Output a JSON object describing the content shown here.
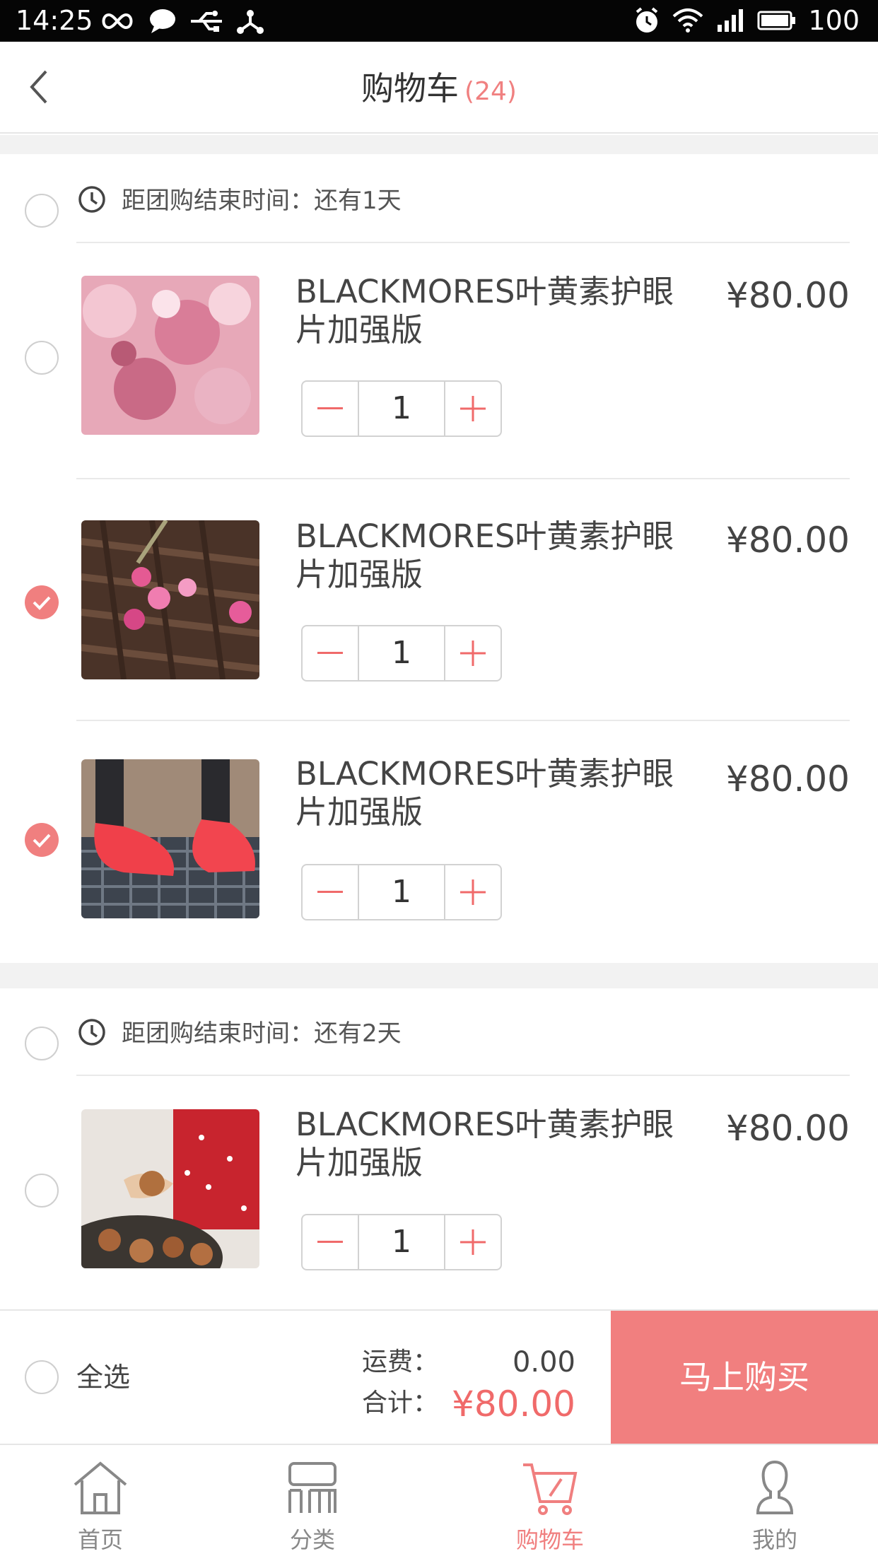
{
  "status_bar": {
    "time": "14:25",
    "level": "100"
  },
  "header": {
    "title": "购物车",
    "count": "(24)"
  },
  "groups": [
    {
      "countdown": "距团购结束时间：还有1天"
    },
    {
      "countdown": "距团购结束时间：还有2天"
    }
  ],
  "items": [
    {
      "name": "BLACKMORES叶黄素护眼片加强版",
      "price": "¥80.00",
      "qty": "1",
      "selected": false
    },
    {
      "name": "BLACKMORES叶黄素护眼片加强版",
      "price": "¥80.00",
      "qty": "1",
      "selected": true
    },
    {
      "name": "BLACKMORES叶黄素护眼片加强版",
      "price": "¥80.00",
      "qty": "1",
      "selected": true
    },
    {
      "name": "BLACKMORES叶黄素护眼片加强版",
      "price": "¥80.00",
      "qty": "1",
      "selected": false
    }
  ],
  "checkout": {
    "select_all": "全选",
    "shipping_label": "运费：",
    "shipping_value": "0.00",
    "total_label": "合计：",
    "total_value": "¥80.00",
    "buy_label": "马上购买"
  },
  "tabs": [
    {
      "label": "首页",
      "icon": "home-icon"
    },
    {
      "label": "分类",
      "icon": "category-icon"
    },
    {
      "label": "购物车",
      "icon": "cart-icon",
      "active": true
    },
    {
      "label": "我的",
      "icon": "profile-icon"
    }
  ],
  "colors": {
    "accent": "#f17f7f",
    "price_red": "#f06a6a"
  }
}
